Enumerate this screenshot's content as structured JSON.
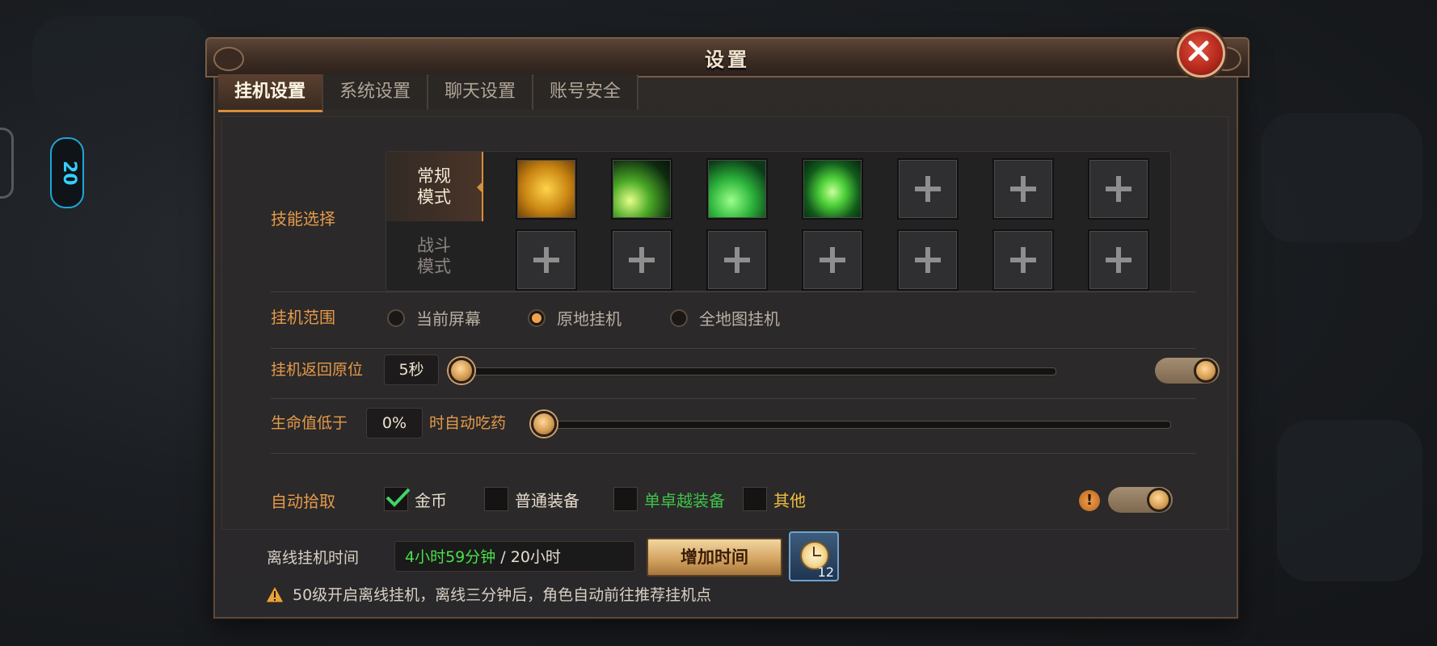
{
  "window": {
    "title": "设置"
  },
  "tabs": [
    {
      "label": "挂机设置",
      "active": true
    },
    {
      "label": "系统设置",
      "active": false
    },
    {
      "label": "聊天设置",
      "active": false
    },
    {
      "label": "账号安全",
      "active": false
    }
  ],
  "skills": {
    "label": "技能选择",
    "modes": [
      {
        "label": "常规\n模式",
        "active": true
      },
      {
        "label": "战斗\n模式",
        "active": false
      }
    ],
    "normal_slots": [
      "golden-dragon-skill-icon",
      "green-meteor-skill-icon",
      "green-beam-skill-icon",
      "green-flame-ring-skill-icon",
      "empty",
      "empty",
      "empty"
    ],
    "combat_slots": [
      "empty",
      "empty",
      "empty",
      "empty",
      "empty",
      "empty",
      "empty"
    ]
  },
  "range": {
    "label": "挂机范围",
    "options": [
      {
        "label": "当前屏幕",
        "selected": false
      },
      {
        "label": "原地挂机",
        "selected": true
      },
      {
        "label": "全地图挂机",
        "selected": false
      }
    ]
  },
  "return": {
    "label": "挂机返回原位",
    "value": "5秒",
    "slider_fraction": 0.0,
    "toggle_on": true
  },
  "hp": {
    "label_prefix": "生命值低于",
    "value": "0%",
    "label_suffix": "时自动吃药",
    "slider_fraction": 0.0
  },
  "pickup": {
    "label": "自动拾取",
    "options": [
      {
        "label": "金币",
        "checked": true,
        "color": "#e6dccd"
      },
      {
        "label": "普通装备",
        "checked": false,
        "color": "#e6dccd"
      },
      {
        "label": "单卓越装备",
        "checked": false,
        "color": "#3fc24a"
      },
      {
        "label": "其他",
        "checked": false,
        "color": "#f0c040"
      }
    ],
    "toggle_on": true,
    "info_icon": "!"
  },
  "offline": {
    "label": "离线挂机时间",
    "remaining": "4小时59分钟",
    "total": " / 20小时",
    "add_button": "增加时间",
    "item_count": "12",
    "notice": "50级开启离线挂机，离线三分钟后，角色自动前往推荐挂机点"
  },
  "side_badge": "20"
}
